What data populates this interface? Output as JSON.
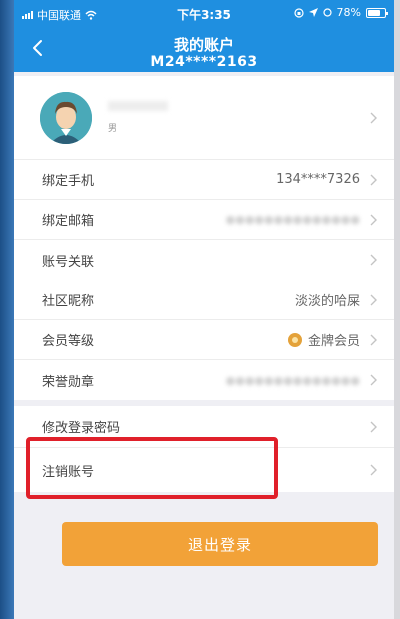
{
  "status_bar": {
    "carrier": "中国联通",
    "time": "下午3:35",
    "battery": "78%",
    "battery_level": 0.78
  },
  "nav": {
    "title": "我的账户",
    "subtitle": "M24****2163",
    "back_icon": "chevron-left-icon"
  },
  "profile": {
    "gender": "男"
  },
  "group1": [
    {
      "label": "绑定手机",
      "value": "134****7326"
    },
    {
      "label": "绑定邮箱",
      "value": ""
    },
    {
      "label": "账号关联",
      "value": ""
    }
  ],
  "group2": [
    {
      "label": "社区昵称",
      "value": "淡淡的哈屎"
    },
    {
      "label": "会员等级",
      "value": "金牌会员"
    },
    {
      "label": "荣誉勋章",
      "value": ""
    }
  ],
  "group3": [
    {
      "label": "修改登录密码"
    },
    {
      "label": "注销账号"
    }
  ],
  "logout": {
    "label": "退出登录"
  },
  "colors": {
    "header": "#1f8fe0",
    "button": "#f2a238",
    "highlight": "#e0202a"
  }
}
